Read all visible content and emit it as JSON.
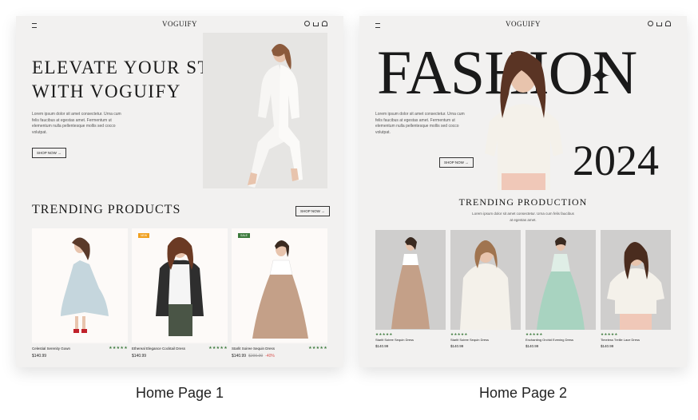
{
  "page1": {
    "logo": "VOGUIFY",
    "hero_title_line1": "ELEVATE YOUR STYLE",
    "hero_title_line2": "WITH VOGUIFY",
    "hero_text": "Lorem ipsum dolor sit amet consectetur. Urna cum felis faucibus at egestas amet. Fermentum ut elementum nulla pellentesque mollis sed cocco volutpat.",
    "shop_now": "SHOP NOW",
    "trending_title": "TRENDING PRODUCTS",
    "products": [
      {
        "name": "Celestial Serenity Gown",
        "price": "$140.99",
        "stars": "★★★★★",
        "badge": ""
      },
      {
        "name": "Ethereal Elegance Cocktail Dress",
        "price": "$140.99",
        "stars": "★★★★★",
        "badge": "NEW"
      },
      {
        "name": "Starlit Soiree Sequin Dress",
        "price": "$140.99",
        "old_price": "$200.00",
        "discount": "-40%",
        "stars": "★★★★★",
        "badge": "SALE"
      }
    ]
  },
  "page2": {
    "logo": "VOGUIFY",
    "fashion_word": "FASHION",
    "year": "2024",
    "hero_text": "Lorem ipsum dolor sit amet consectetur. Urna cum felis faucibus at egestas amet. Fermentum ut elementum nulla pellentesque mollis sed cocco volutpat.",
    "shop_now": "SHOP NOW",
    "trending_title": "TRENDING PRODUCTION",
    "trending_sub": "Lorem ipsum dolor sit amet consectetur. Urna cum felis faucibus at egestas amet.",
    "products": [
      {
        "name": "Starlit Soiree Sequin Dress",
        "price": "$140.99",
        "stars": "★★★★★"
      },
      {
        "name": "Starlit Soiree Sequin Dress",
        "price": "$140.99",
        "stars": "★★★★★"
      },
      {
        "name": "Enchanting Orchid Evening Dress",
        "price": "$140.99",
        "stars": "★★★★★"
      },
      {
        "name": "Timeless Treille Lace Dress",
        "price": "$140.99",
        "stars": "★★★★★"
      }
    ]
  },
  "captions": {
    "page1": "Home Page 1",
    "page2": "Home Page 2"
  },
  "colors": {
    "page_bg": "#f2f1f0",
    "badge_new": "#f0a020",
    "badge_sale": "#3c7a3c",
    "stars": "#3c7a3c",
    "discount": "#d9534f"
  },
  "icons": [
    "menu-icon",
    "search-icon",
    "cart-icon",
    "user-icon",
    "sparkle-icon",
    "arrow-right-icon"
  ]
}
